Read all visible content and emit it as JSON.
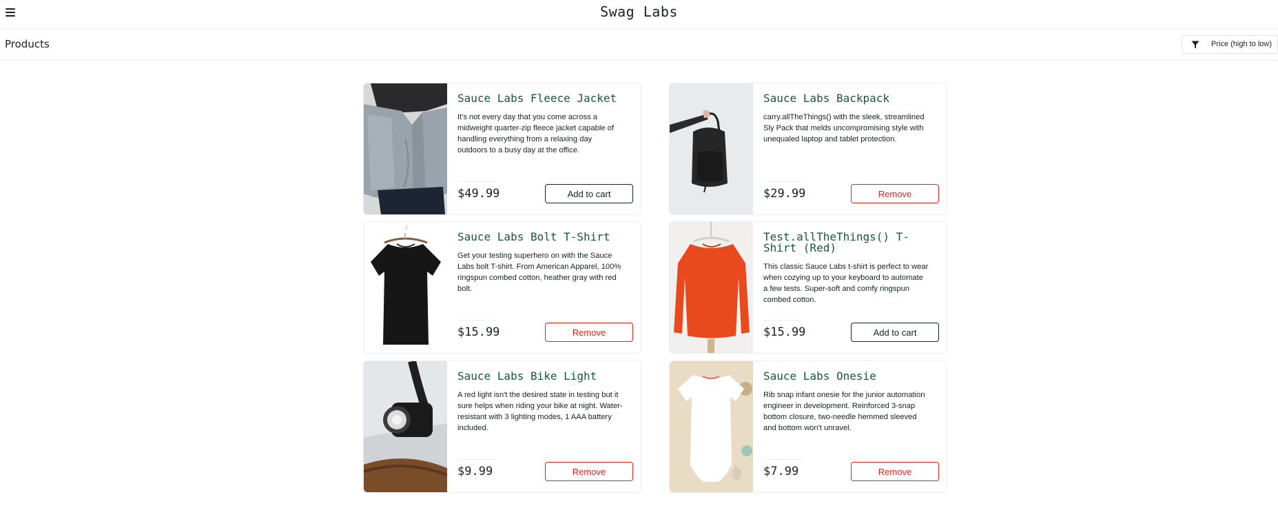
{
  "header": {
    "logo": "Swag Labs",
    "menu_icon": "hamburger-menu-icon"
  },
  "subheader": {
    "title": "Products",
    "sort_icon": "filter-icon",
    "sort_selected": "Price (high to low)"
  },
  "products": [
    {
      "name": "Sauce Labs Fleece Jacket",
      "description": "It's not every day that you come across a midweight quarter-zip fleece jacket capable of handling everything from a relaxing day outdoors to a busy day at the office.",
      "price": "$49.99",
      "button": "Add to cart",
      "image": "fleece-jacket-image"
    },
    {
      "name": "Sauce Labs Backpack",
      "description": "carry.allTheThings() with the sleek, streamlined Sly Pack that melds uncompromising style with unequaled laptop and tablet protection.",
      "price": "$29.99",
      "button": "Remove",
      "image": "backpack-image"
    },
    {
      "name": "Sauce Labs Bolt T-Shirt",
      "description": "Get your testing superhero on with the Sauce Labs bolt T-shirt. From American Apparel, 100% ringspun combed cotton, heather gray with red bolt.",
      "price": "$15.99",
      "button": "Remove",
      "image": "bolt-tshirt-image"
    },
    {
      "name": "Test.allTheThings() T-Shirt (Red)",
      "description": "This classic Sauce Labs t-shirt is perfect to wear when cozying up to your keyboard to automate a few tests. Super-soft and comfy ringspun combed cotton.",
      "price": "$15.99",
      "button": "Add to cart",
      "image": "red-tshirt-image"
    },
    {
      "name": "Sauce Labs Bike Light",
      "description": "A red light isn't the desired state in testing but it sure helps when riding your bike at night. Water-resistant with 3 lighting modes, 1 AAA battery included.",
      "price": "$9.99",
      "button": "Remove",
      "image": "bike-light-image"
    },
    {
      "name": "Sauce Labs Onesie",
      "description": "Rib snap infant onesie for the junior automation engineer in development. Reinforced 3-snap bottom closure, two-needle hemmed sleeved and bottom won't unravel.",
      "price": "$7.99",
      "button": "Remove",
      "image": "onesie-image"
    }
  ],
  "colors": {
    "title_green": "#18583a",
    "remove_red": "#e2231a",
    "text_dark": "#132322",
    "border": "#ededed"
  }
}
